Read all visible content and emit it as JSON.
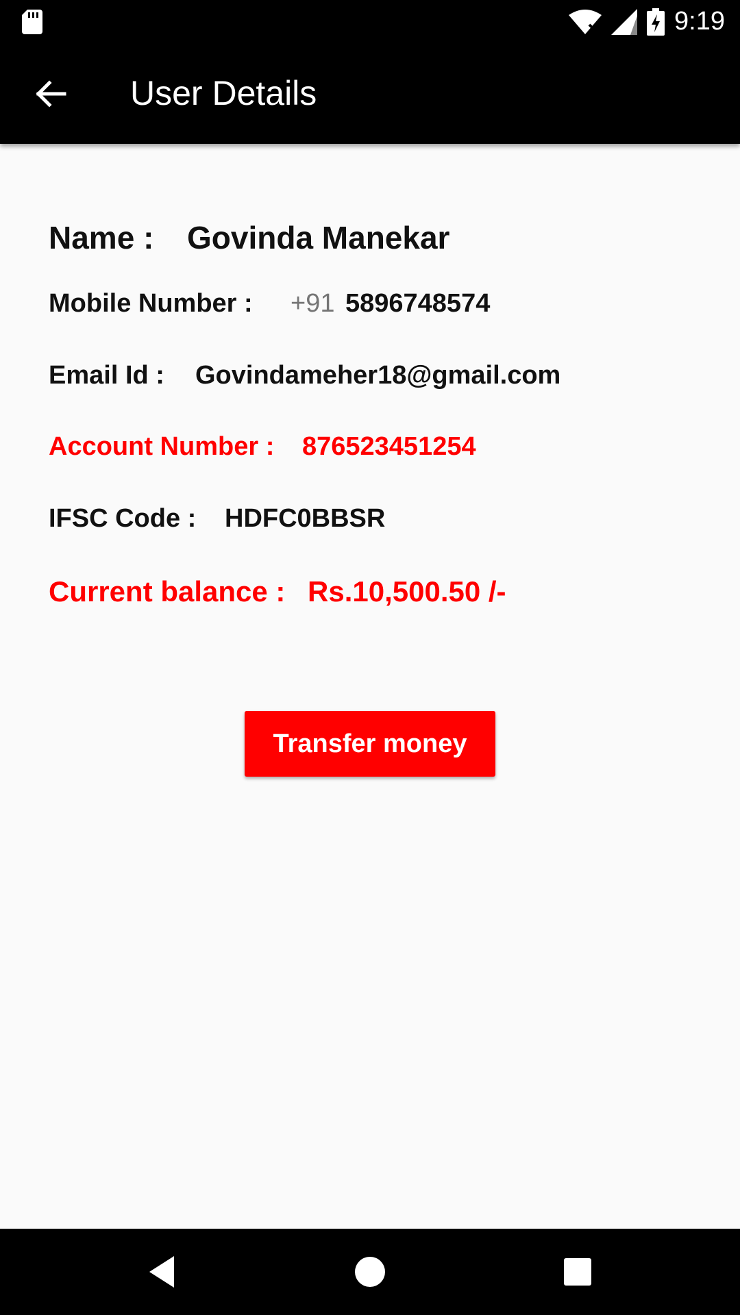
{
  "status_bar": {
    "time": "9:19",
    "icons": [
      "sd-card-icon",
      "wifi-off-icon",
      "signal-icon",
      "battery-charging-icon"
    ]
  },
  "app_bar": {
    "title": "User Details",
    "back_icon": "arrow-back-icon"
  },
  "details": {
    "name_label": "Name :",
    "name_value": "Govinda Manekar",
    "mobile_label": "Mobile Number :",
    "mobile_prefix": "+91",
    "mobile_value": "5896748574",
    "email_label": "Email Id :",
    "email_value": "Govindameher18@gmail.com",
    "account_label": "Account Number :",
    "account_value": "876523451254",
    "ifsc_label": "IFSC Code :",
    "ifsc_value": "HDFC0BBSR",
    "balance_label": "Current balance :",
    "balance_value": "Rs.10,500.50 /-"
  },
  "actions": {
    "transfer_label": "Transfer money"
  },
  "nav_bar": {
    "icons": [
      "nav-back-icon",
      "nav-home-icon",
      "nav-recents-icon"
    ]
  },
  "colors": {
    "accent": "#ff0000",
    "bar": "#000000",
    "background": "#fafafa"
  }
}
